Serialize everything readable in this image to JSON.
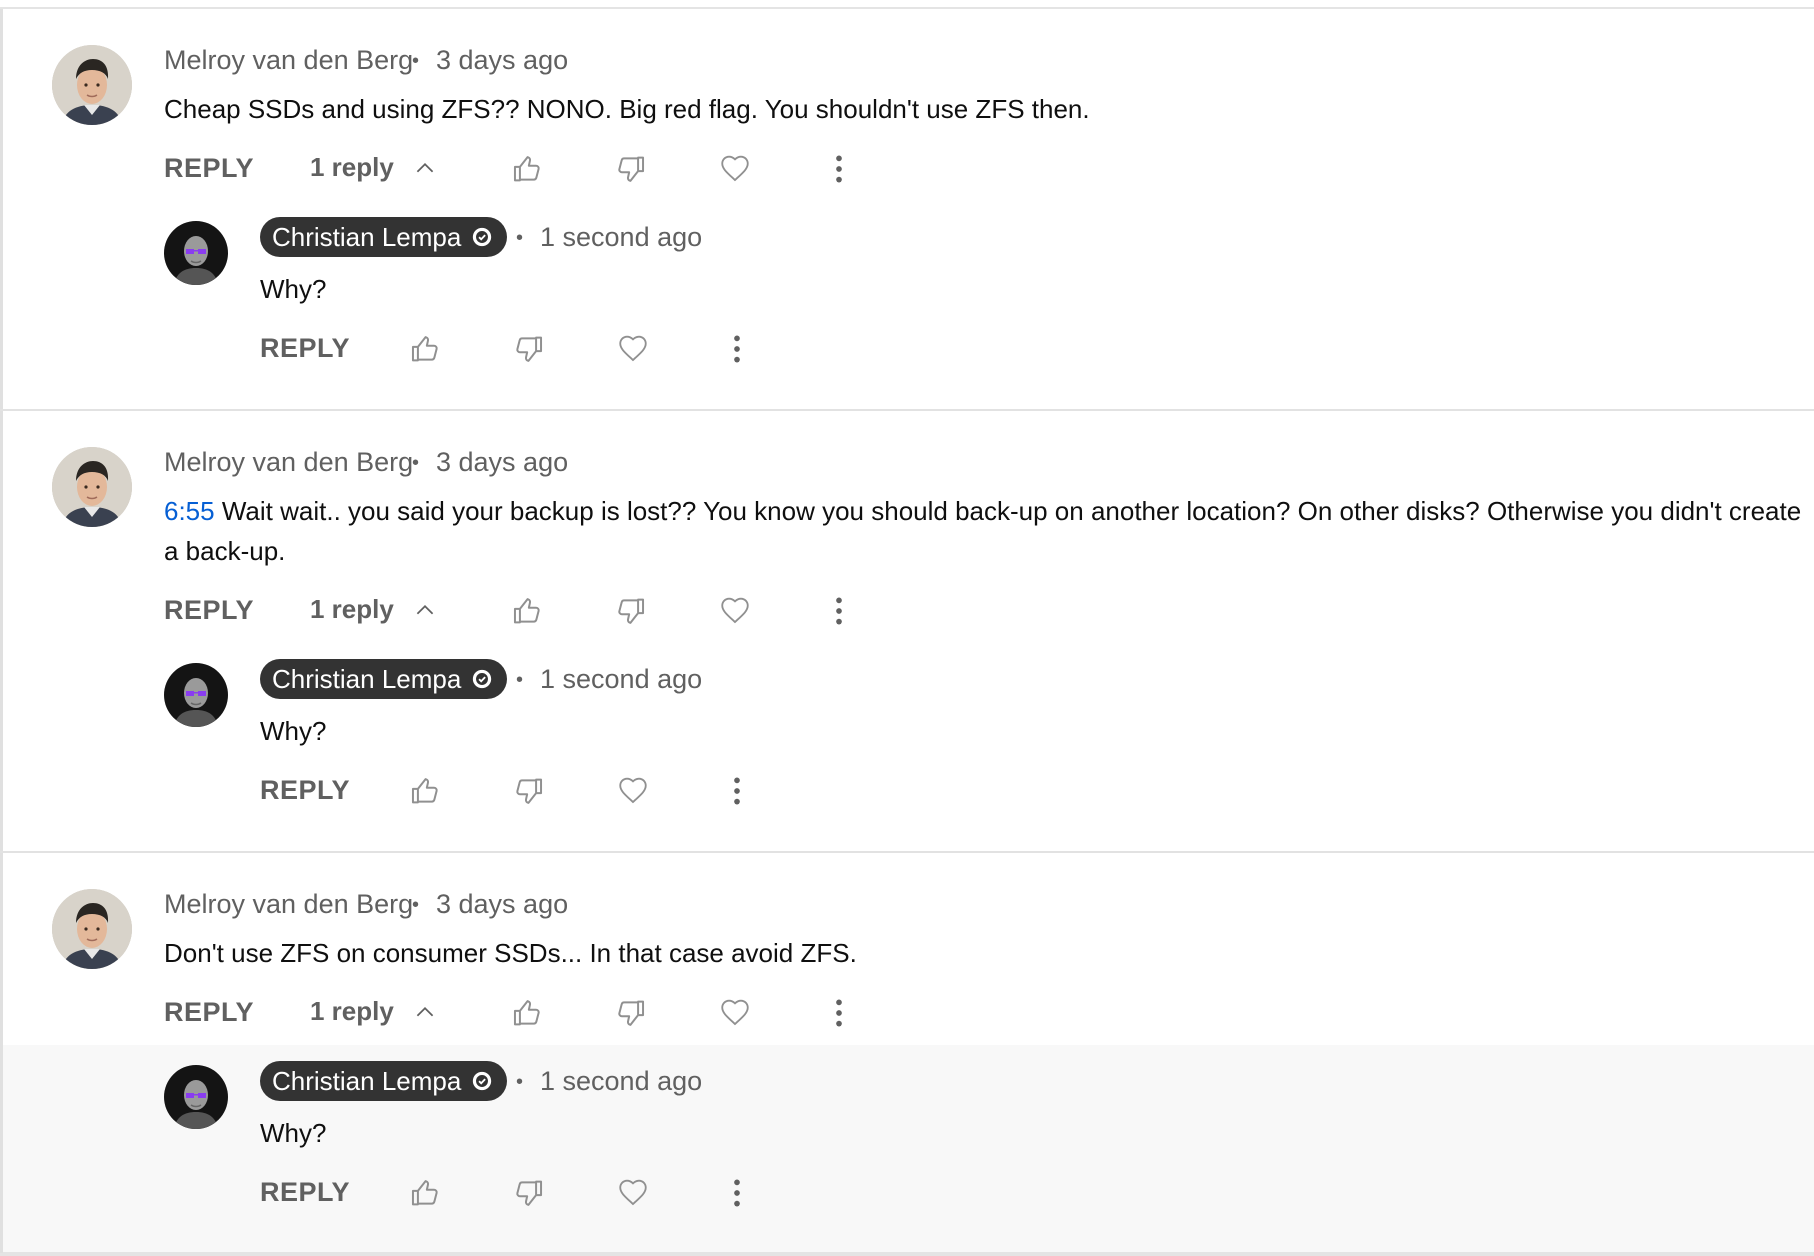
{
  "comments": [
    {
      "author": "Melroy van den Berg",
      "time": "3 days ago",
      "timestamp_link": "",
      "text": "Cheap SSDs and using ZFS?? NONO. Big red flag. You shouldn't use ZFS then.",
      "reply_label": "REPLY",
      "replies_count": "1 reply",
      "reply": {
        "author": "Christian Lempa",
        "time": "1 second ago",
        "text": "Why?",
        "reply_label": "REPLY"
      }
    },
    {
      "author": "Melroy van den Berg",
      "time": "3 days ago",
      "timestamp_link": "6:55",
      "text": "Wait wait.. you said your backup is lost?? You know you should back-up on another location? On other disks? Otherwise you didn't create a back-up.",
      "reply_label": "REPLY",
      "replies_count": "1 reply",
      "reply": {
        "author": "Christian Lempa",
        "time": "1 second ago",
        "text": "Why?",
        "reply_label": "REPLY"
      }
    },
    {
      "author": "Melroy van den Berg",
      "time": "3 days ago",
      "timestamp_link": "",
      "text": "Don't use ZFS on consumer SSDs... In that case avoid ZFS.",
      "reply_label": "REPLY",
      "replies_count": "1 reply",
      "reply": {
        "author": "Christian Lempa",
        "time": "1 second ago",
        "text": "Why?",
        "reply_label": "REPLY"
      }
    }
  ],
  "icons": {
    "like": "thumbs-up-icon",
    "dislike": "thumbs-down-icon",
    "heart": "heart-icon",
    "more": "more-vert-icon",
    "collapse": "chevron-up-icon",
    "verified": "verified-check-icon"
  },
  "colors": {
    "timestamp_link": "#065fd4",
    "owner_badge_bg": "#333333",
    "muted_text": "#606060",
    "highlight_bg": "#f8f8f8"
  }
}
